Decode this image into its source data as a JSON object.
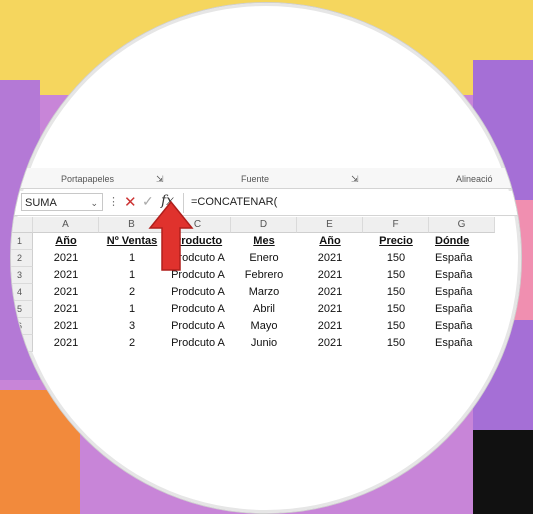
{
  "ribbon": {
    "groups": [
      "Portapapeles",
      "Fuente",
      "Alineació"
    ]
  },
  "formula_bar": {
    "name_box": "SUMA",
    "formula": "=CONCATENAR("
  },
  "sheet": {
    "columns": [
      "A",
      "B",
      "C",
      "D",
      "E",
      "F",
      "G"
    ],
    "rows": [
      "1",
      "2",
      "3",
      "4",
      "5",
      "6"
    ],
    "header": [
      "Año",
      "Nº Ventas",
      "Producto",
      "Mes",
      "Año",
      "Precio",
      "Dónde"
    ],
    "data": [
      [
        "2021",
        "1",
        "Prodcuto A",
        "Enero",
        "2021",
        "150",
        "España"
      ],
      [
        "2021",
        "1",
        "Prodcuto A",
        "Febrero",
        "2021",
        "150",
        "España"
      ],
      [
        "2021",
        "2",
        "Prodcuto A",
        "Marzo",
        "2021",
        "150",
        "España"
      ],
      [
        "2021",
        "1",
        "Prodcuto A",
        "Abril",
        "2021",
        "150",
        "España"
      ],
      [
        "2021",
        "3",
        "Prodcuto A",
        "Mayo",
        "2021",
        "150",
        "España"
      ],
      [
        "2021",
        "2",
        "Prodcuto A",
        "Junio",
        "2021",
        "150",
        "España"
      ]
    ]
  },
  "colors": {
    "arrow": "#e0322d",
    "cancel": "#cc3333"
  }
}
